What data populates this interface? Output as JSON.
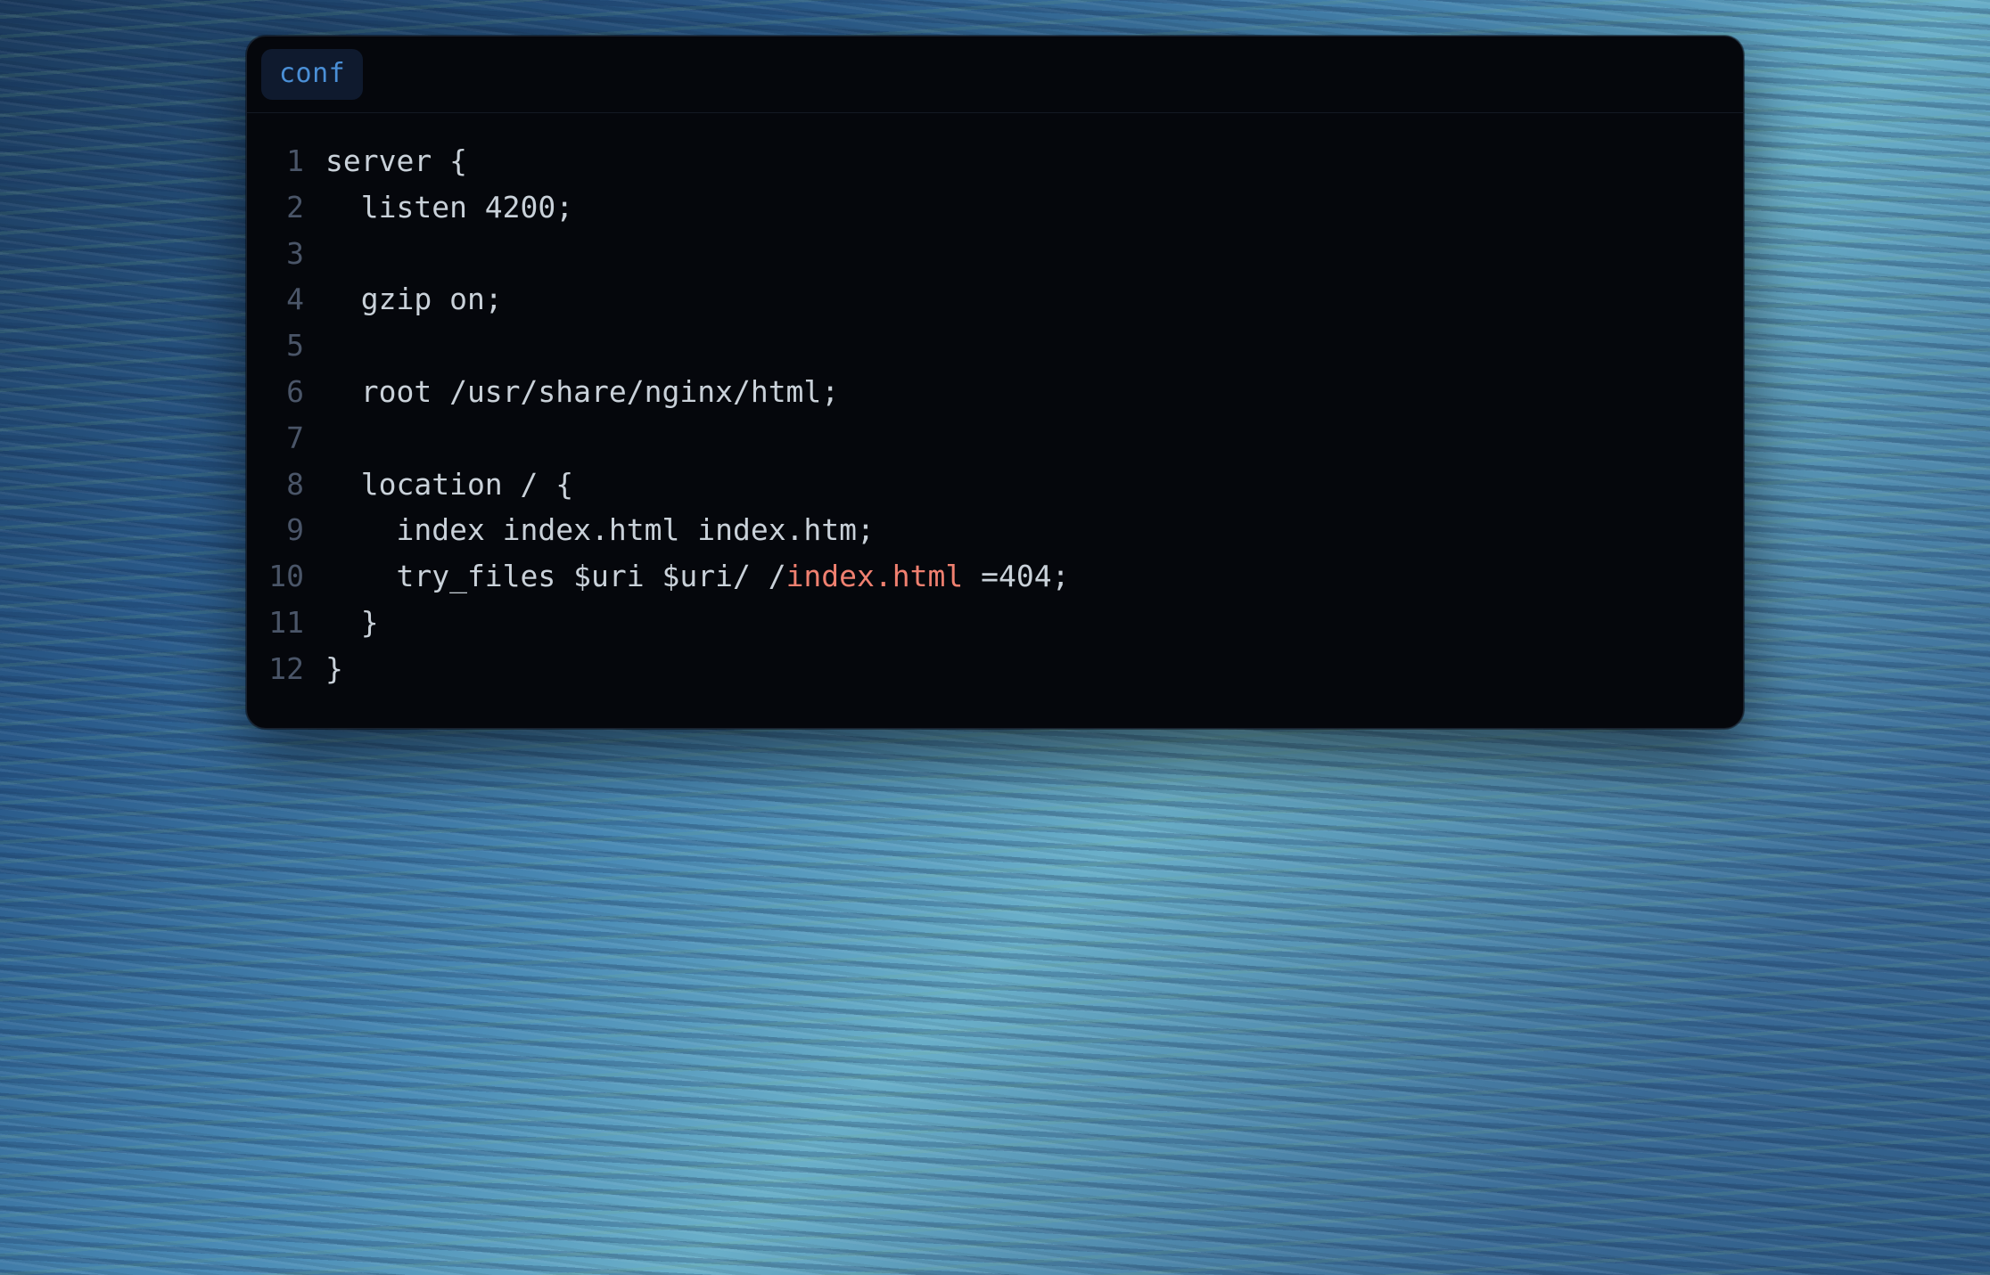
{
  "language_badge": "conf",
  "code": {
    "lines": [
      {
        "n": "1",
        "plain": "server {"
      },
      {
        "n": "2",
        "plain": "  listen 4200;"
      },
      {
        "n": "3",
        "plain": ""
      },
      {
        "n": "4",
        "plain": "  gzip on;"
      },
      {
        "n": "5",
        "plain": ""
      },
      {
        "n": "6",
        "plain": "  root /usr/share/nginx/html;"
      },
      {
        "n": "7",
        "plain": ""
      },
      {
        "n": "8",
        "plain": "  location / {"
      },
      {
        "n": "9",
        "plain": "    index index.html index.htm;"
      },
      {
        "n": "10",
        "pre": "    try_files $uri $uri/ /",
        "hl": "index.html",
        "post": " =404;"
      },
      {
        "n": "11",
        "plain": "  }"
      },
      {
        "n": "12",
        "plain": "}"
      }
    ]
  },
  "colors": {
    "badge_bg": "#0f1a2e",
    "badge_fg": "#4a8fd6",
    "editor_bg": "#05070c",
    "text": "#c9d1d9",
    "gutter": "#4a5568",
    "highlight": "#f08070"
  }
}
